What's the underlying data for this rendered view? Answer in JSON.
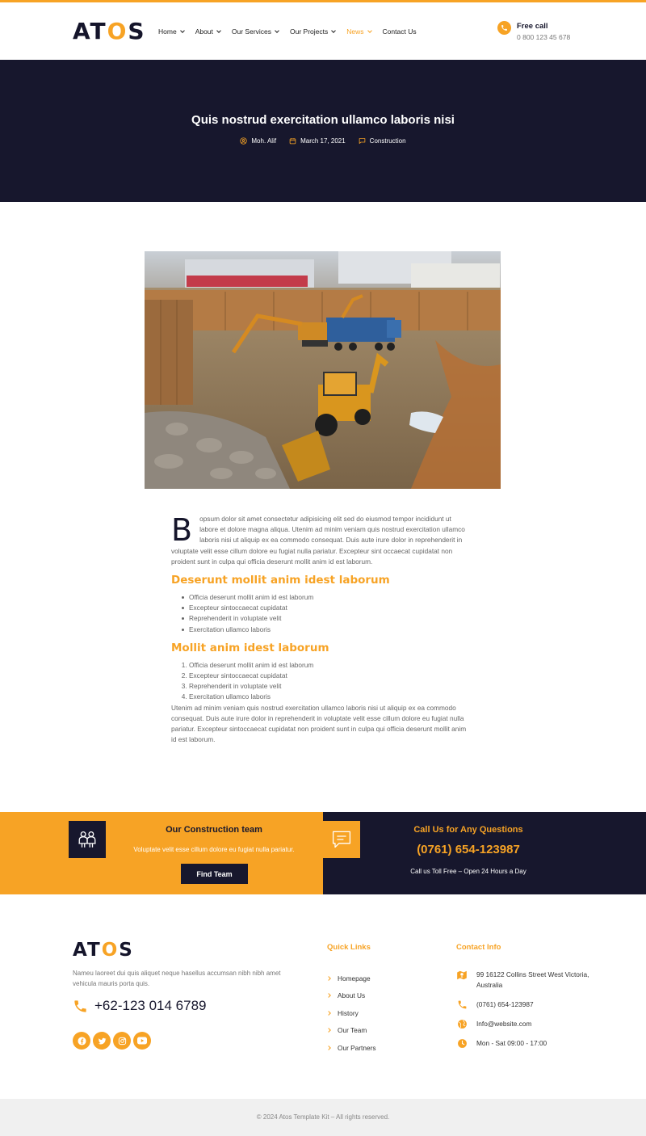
{
  "colors": {
    "accent": "#f7a325",
    "dark": "#17172d"
  },
  "header": {
    "logo": {
      "left": "AT",
      "o": "O",
      "right": "S"
    },
    "nav": [
      "Home",
      "About",
      "Our Services",
      "Our Projects",
      "News",
      "Contact Us"
    ],
    "active": "News",
    "free_call_label": "Free call",
    "free_call_number": "0 800 123 45 678"
  },
  "hero": {
    "title": "Quis nostrud exercitation ullamco laboris nisi",
    "author": "Moh. Alif",
    "date": "March 17, 2021",
    "category": "Construction"
  },
  "article": {
    "dropcap": "B",
    "intro": "opsum dolor sit amet consectetur adipisicing elit sed do eiusmod tempor incididunt ut labore et dolore magna aliqua. Utenim ad minim veniam quis nostrud exercitation ullamco laboris nisi ut aliquip ex ea commodo consequat. Duis aute irure dolor in reprehenderit in voluptate velit esse cillum dolore eu fugiat nulla pariatur. Excepteur sint occaecat cupidatat non proident sunt in culpa qui officia deserunt mollit anim id est laborum.",
    "heading1": "Deserunt mollit anim idest laborum",
    "bullets": [
      "Officia deserunt mollit anim id est laborum",
      "Excepteur sintoccaecat cupidatat",
      "Reprehenderit in voluptate velit",
      "Exercitation ullamco laboris"
    ],
    "heading2": "Mollit anim idest laborum",
    "numbered": [
      "Officia deserunt mollit anim id est laborum",
      "Excepteur sintoccaecat cupidatat",
      "Reprehenderit in voluptate velit",
      "Exercitation ullamco laboris"
    ],
    "outro": "Utenim ad minim veniam quis nostrud exercitation ullamco laboris nisi ut aliquip ex ea commodo consequat. Duis aute irure dolor in reprehenderit in voluptate velit esse cillum dolore eu fugiat nulla pariatur. Excepteur sintoccaecat cupidatat non proident sunt in culpa qui officia deserunt mollit anim id est laborum."
  },
  "cta": {
    "team_title": "Our Construction team",
    "team_desc": "Voluptate velit esse cillum dolore eu fugiat nulla pariatur.",
    "team_button": "Find Team",
    "call_title": "Call Us for Any Questions",
    "call_phone": "(0761) 654-123987",
    "call_sub": "Call us Toll Free – Open 24 Hours a Day"
  },
  "footer": {
    "logo": {
      "left": "AT",
      "o": "O",
      "right": "S"
    },
    "description": "Nameu laoreet dui quis aliquet neque hasellus accumsan nibh nibh amet vehicula mauris porta quis.",
    "phone": "+62-123 014 6789",
    "socials": [
      "facebook-icon",
      "twitter-icon",
      "instagram-icon",
      "youtube-icon"
    ],
    "quick_links_title": "Quick Links",
    "quick_links": [
      "Homepage",
      "About Us",
      "History",
      "Our Team",
      "Our Partners"
    ],
    "contact_title": "Contact Info",
    "contact": {
      "address": "99 16122 Collins Street West Victoria, Australia",
      "phone": "(0761) 654-123987",
      "email": "Info@website.com",
      "hours": "Mon - Sat 09:00 - 17:00"
    },
    "copyright": "© 2024 Atos Template Kit – All rights reserved."
  }
}
